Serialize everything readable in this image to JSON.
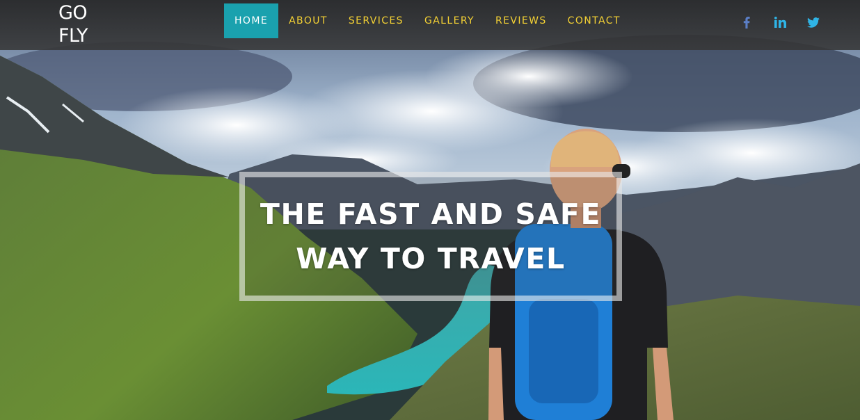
{
  "brand": {
    "line1": "GO",
    "line2": "FLY"
  },
  "nav": {
    "items": [
      {
        "label": "HOME",
        "active": true
      },
      {
        "label": "ABOUT",
        "active": false
      },
      {
        "label": "SERVICES",
        "active": false
      },
      {
        "label": "GALLERY",
        "active": false
      },
      {
        "label": "REVIEWS",
        "active": false
      },
      {
        "label": "CONTACT",
        "active": false
      }
    ]
  },
  "social": [
    {
      "icon": "facebook-icon",
      "color": "#5b7fc7"
    },
    {
      "icon": "linkedin-icon",
      "color": "#2fb4e6"
    },
    {
      "icon": "twitter-icon",
      "color": "#2fb4e6"
    }
  ],
  "hero": {
    "headline_line1": "THE FAST AND SAFE",
    "headline_line2": "WAY TO TRAVEL"
  },
  "colors": {
    "accent": "#1aa1ae",
    "nav_text": "#f5d234",
    "header_bg": "#333333"
  }
}
